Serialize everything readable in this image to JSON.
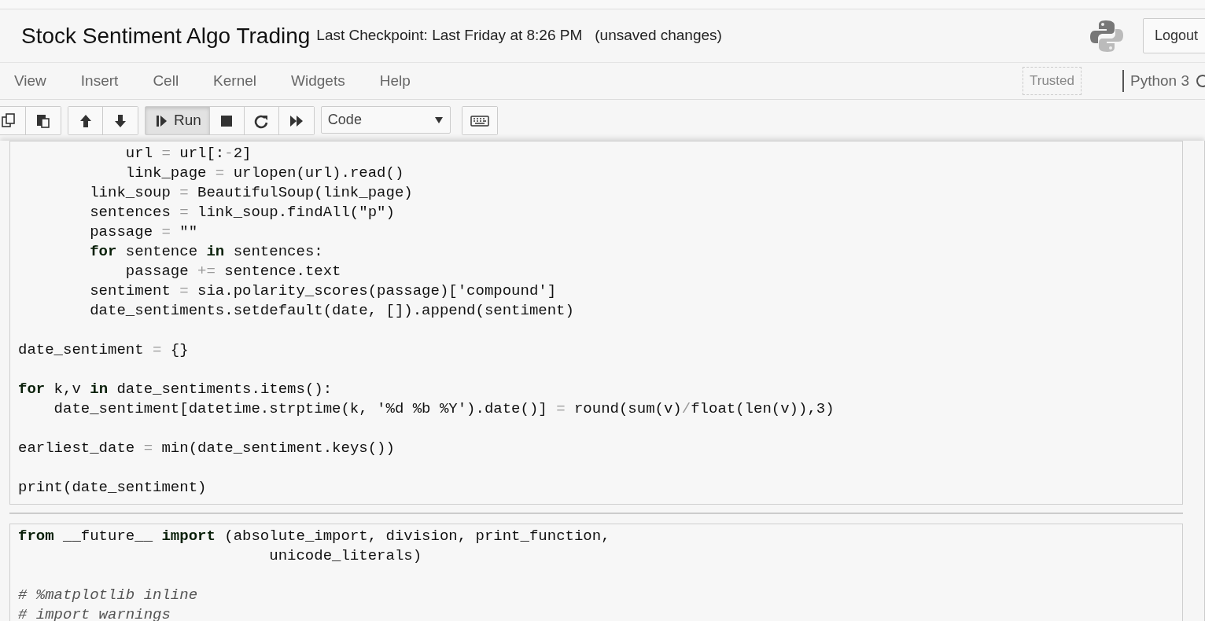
{
  "header": {
    "title": "Stock Sentiment Algo Trading",
    "checkpoint": "Last Checkpoint: Last Friday at 8:26 PM",
    "save_status": "(unsaved changes)",
    "logout": "Logout"
  },
  "menu": [
    "View",
    "Insert",
    "Cell",
    "Kernel",
    "Widgets",
    "Help"
  ],
  "trusted": "Trusted",
  "kernel": "Python 3",
  "toolbar": {
    "groups": [
      [
        {
          "kind": "copy"
        },
        {
          "kind": "paste"
        }
      ],
      [
        {
          "kind": "up"
        },
        {
          "kind": "down"
        }
      ],
      [
        {
          "kind": "run",
          "label": "Run",
          "pressed": true
        },
        {
          "kind": "stop",
          "pressed": false
        },
        {
          "kind": "restart",
          "pressed": false
        },
        {
          "kind": "fastforward",
          "pressed": false
        }
      ]
    ],
    "cell_type": "Code"
  },
  "cells": [
    {
      "blocks": [
        [
          [
            {
              "kind": "plain",
              "text": "            url "
            },
            {
              "kind": "operator",
              "text": "="
            },
            {
              "kind": "plain",
              "text": " url[:"
            },
            {
              "kind": "operator",
              "text": "-"
            },
            {
              "kind": "plain",
              "text": "2]"
            }
          ],
          [
            {
              "kind": "plain",
              "text": "            link_page "
            },
            {
              "kind": "operator",
              "text": "="
            },
            {
              "kind": "plain",
              "text": " urlopen(url).read()"
            }
          ],
          [
            {
              "kind": "plain",
              "text": "        link_soup "
            },
            {
              "kind": "operator",
              "text": "="
            },
            {
              "kind": "plain",
              "text": " BeautifulSoup(link_page)"
            }
          ],
          [
            {
              "kind": "plain",
              "text": "        sentences "
            },
            {
              "kind": "operator",
              "text": "="
            },
            {
              "kind": "plain",
              "text": " link_soup.findAll(\"p\")"
            }
          ],
          [
            {
              "kind": "plain",
              "text": "        passage "
            },
            {
              "kind": "operator",
              "text": "="
            },
            {
              "kind": "plain",
              "text": " \"\""
            }
          ],
          [
            {
              "kind": "keyword",
              "text": "        for"
            },
            {
              "kind": "plain",
              "text": " sentence "
            },
            {
              "kind": "keyword",
              "text": "in"
            },
            {
              "kind": "plain",
              "text": " sentences:"
            }
          ],
          [
            {
              "kind": "plain",
              "text": "            passage "
            },
            {
              "kind": "operator",
              "text": "+="
            },
            {
              "kind": "plain",
              "text": " sentence.text"
            }
          ],
          [
            {
              "kind": "plain",
              "text": "        sentiment "
            },
            {
              "kind": "operator",
              "text": "="
            },
            {
              "kind": "plain",
              "text": " sia.polarity_scores(passage)['compound']"
            }
          ],
          [
            {
              "kind": "plain",
              "text": "        date_sentiments.setdefault(date, []).append(sentiment)"
            }
          ]
        ],
        [
          [
            {
              "kind": "plain",
              "text": "date_sentiment "
            },
            {
              "kind": "operator",
              "text": "="
            },
            {
              "kind": "plain",
              "text": " {}"
            }
          ]
        ],
        [
          [
            {
              "kind": "keyword",
              "text": "for"
            },
            {
              "kind": "plain",
              "text": " k,v "
            },
            {
              "kind": "keyword",
              "text": "in"
            },
            {
              "kind": "plain",
              "text": " date_sentiments.items():"
            }
          ],
          [
            {
              "kind": "plain",
              "text": "    date_sentiment[datetime.strptime(k, '%d %b %Y').date()] "
            },
            {
              "kind": "operator",
              "text": "="
            },
            {
              "kind": "plain",
              "text": " round(sum(v)"
            },
            {
              "kind": "operator",
              "text": "/"
            },
            {
              "kind": "plain",
              "text": "float(len(v)),3)"
            }
          ]
        ],
        [
          [
            {
              "kind": "plain",
              "text": "earliest_date "
            },
            {
              "kind": "operator",
              "text": "="
            },
            {
              "kind": "plain",
              "text": " min(date_sentiment.keys())"
            }
          ]
        ],
        [
          [
            {
              "kind": "plain",
              "text": "print(date_sentiment)"
            }
          ]
        ]
      ]
    },
    {
      "blocks": [
        [
          [
            {
              "kind": "keyword",
              "text": "from"
            },
            {
              "kind": "plain",
              "text": " __future__ "
            },
            {
              "kind": "keyword",
              "text": "import"
            },
            {
              "kind": "plain",
              "text": " (absolute_import, division, print_function,"
            }
          ],
          [
            {
              "kind": "plain",
              "text": "                            unicode_literals)"
            }
          ]
        ],
        [
          [
            {
              "kind": "comment",
              "text": "# %matplotlib inline"
            }
          ],
          [
            {
              "kind": "comment",
              "text": "# import warnings"
            }
          ]
        ]
      ]
    }
  ]
}
